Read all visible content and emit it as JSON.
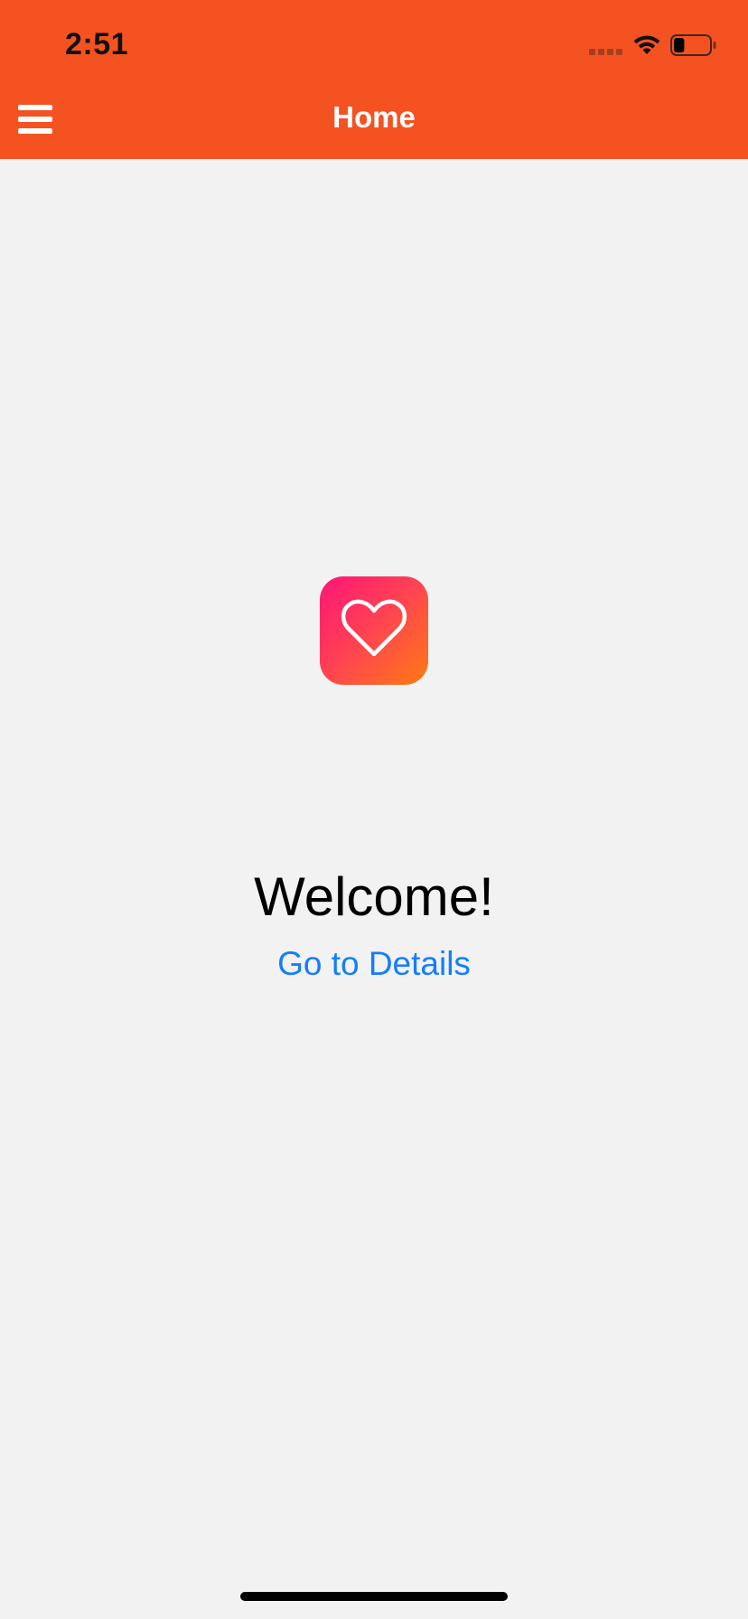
{
  "status_bar": {
    "time": "2:51",
    "signal_icon": "cellular-signal-icon",
    "wifi_icon": "wifi-icon",
    "battery_icon": "battery-icon",
    "battery_level": 0.3
  },
  "header": {
    "title": "Home",
    "menu_icon": "hamburger-menu-icon",
    "background_color": "#f55221"
  },
  "main": {
    "logo_icon": "heart-icon",
    "welcome_text": "Welcome!",
    "details_link": "Go to Details",
    "link_color": "#147efb"
  }
}
